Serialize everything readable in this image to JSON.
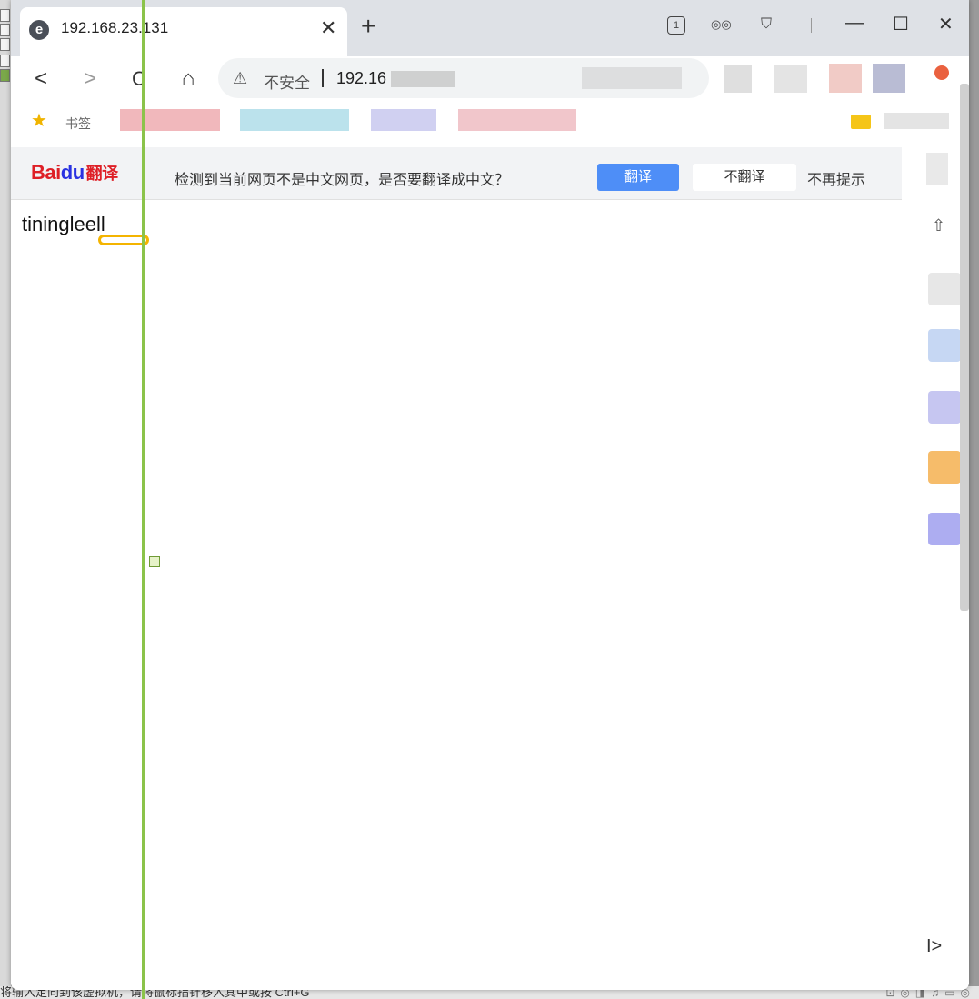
{
  "host": {
    "status_text": "将输入定向到该虚拟机，请将鼠标指针移入其中或按 Ctrl+G",
    "status_icons": "⊡◎◨♫▭◎"
  },
  "tab": {
    "title": "192.168.23.131",
    "favicon_icon": "e",
    "close_glyph": "✕"
  },
  "titlebar": {
    "new_tab_glyph": "+",
    "tab_count": "1",
    "incognito_glyph": "◎◎",
    "shirt_glyph": "⛉",
    "minimize_glyph": "—",
    "maximize_glyph": "☐",
    "close_glyph": "✕"
  },
  "nav": {
    "back_glyph": "<",
    "forward_glyph": ">",
    "reload_glyph": "C",
    "home_glyph": "⌂"
  },
  "omnibox": {
    "warning_glyph": "⚠",
    "security_label": "不安全",
    "url": "192.16"
  },
  "bookmarks": {
    "star_glyph": "★",
    "first_label": "书签"
  },
  "translate_bar": {
    "logo_text": "Bai",
    "logo_paw": "du",
    "logo_suffix": "翻译",
    "message": "检测到当前网页不是中文网页，是否要翻译成中文？",
    "translate_label": "翻译",
    "no_translate_label": "不翻译",
    "never_label": "不再提示"
  },
  "page": {
    "text": "tiningleell"
  },
  "side_panel": {
    "up_glyph": "⇧",
    "expand_glyph": "I>"
  },
  "colors": {
    "accent": "#4e8ef7",
    "guide_line": "#8bc34a",
    "highlight": "#f4b400",
    "baidu_red": "#de1f26",
    "baidu_blue": "#2932e1"
  }
}
